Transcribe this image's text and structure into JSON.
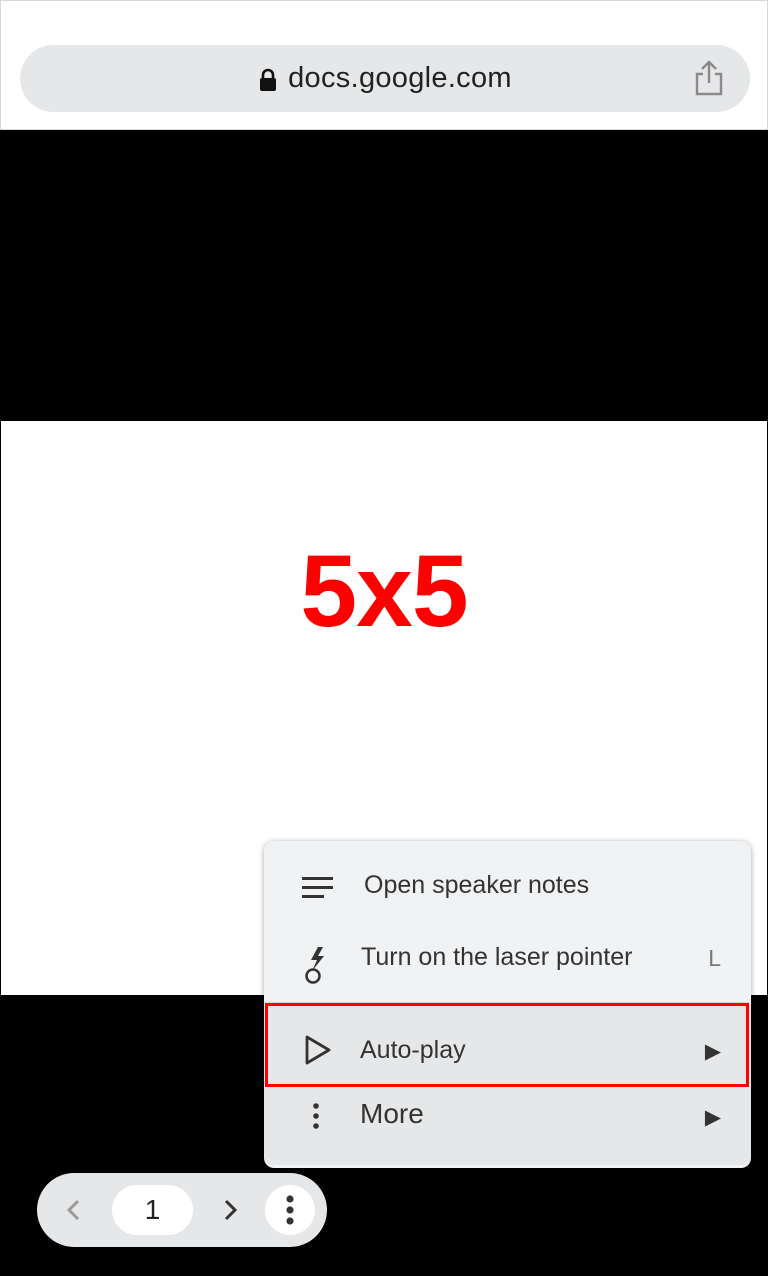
{
  "browser": {
    "url": "docs.google.com",
    "icons": {
      "lock": "lock-icon",
      "share": "share-icon"
    }
  },
  "slide": {
    "title": "5x5",
    "title_color": "#ff0000"
  },
  "menu": {
    "items": [
      {
        "label": "Open speaker notes",
        "icon": "lines-icon"
      },
      {
        "label": "Turn on the laser pointer",
        "icon": "laser-pointer-icon",
        "shortcut": "L"
      },
      {
        "label": "Auto-play",
        "icon": "play-icon",
        "submenu_arrow": "▶"
      },
      {
        "label": "More",
        "icon": "vertical-dots-icon",
        "submenu_arrow": "▶"
      }
    ],
    "highlighted_item": "Auto-play",
    "highlight_color": "#ff0000"
  },
  "nav": {
    "page_number": "1",
    "icons": {
      "prev": "chevron-left-icon",
      "next": "chevron-right-icon",
      "more": "more-vert-icon"
    }
  }
}
